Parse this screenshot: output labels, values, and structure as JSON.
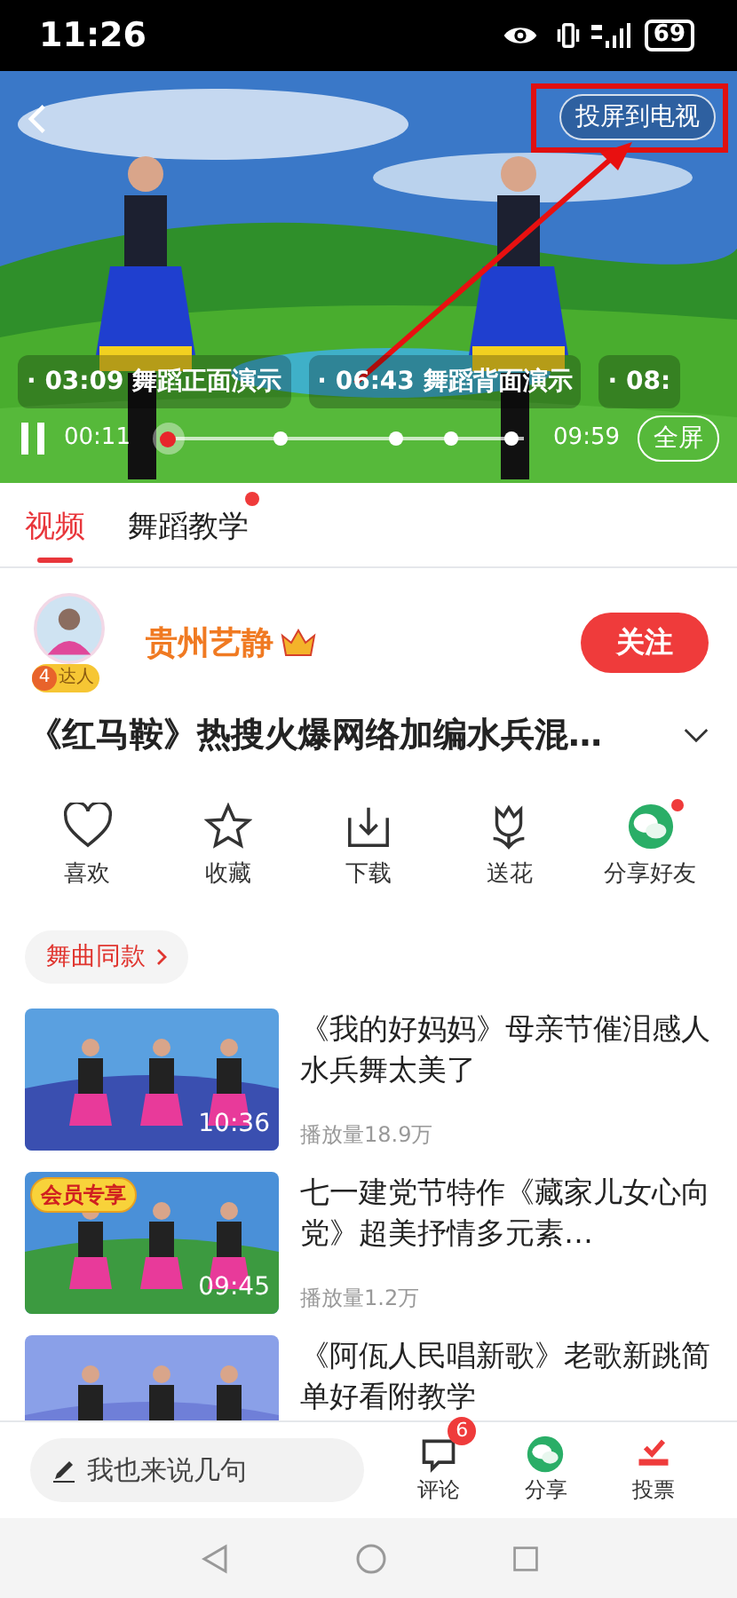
{
  "status_bar": {
    "time": "11:26",
    "battery": "69"
  },
  "player": {
    "cast_button": "投屏到电视",
    "chapters": [
      {
        "text": "· 03:09 舞蹈正面演示"
      },
      {
        "text": "· 06:43 舞蹈背面演示"
      },
      {
        "text": "· 08:"
      }
    ],
    "playing": true,
    "elapsed": "00:11",
    "duration": "09:59",
    "level": 0.02,
    "fullscreen": "全屏"
  },
  "tabs": [
    {
      "label": "视频",
      "selected": true,
      "dot": false
    },
    {
      "label": "舞蹈教学",
      "selected": false,
      "dot": true
    }
  ],
  "author": {
    "name": "贵州艺静",
    "level": "4",
    "rank": "达人",
    "follow": "关注"
  },
  "video_title": "《红马鞍》热搜火爆网络加编水兵混…",
  "actions": [
    {
      "kind": "heart",
      "label": "喜欢",
      "dot": false
    },
    {
      "kind": "star",
      "label": "收藏",
      "dot": false
    },
    {
      "kind": "download",
      "label": "下载",
      "dot": false
    },
    {
      "kind": "flower",
      "label": "送花",
      "dot": false
    },
    {
      "kind": "wechat",
      "label": "分享好友",
      "dot": true
    }
  ],
  "tag": "舞曲同款",
  "related": [
    {
      "title": "《我的好妈妈》母亲节催泪感人水兵舞太美了",
      "views": "播放量18.9万",
      "duration": "10:36"
    },
    {
      "title": "七一建党节特作《藏家儿女心向党》超美抒情多元素…",
      "views": "播放量1.2万",
      "duration": "09:45",
      "badge": "会员专享"
    },
    {
      "title": "《阿佤人民唱新歌》老歌新跳简单好看附教学"
    }
  ],
  "comment_bar": {
    "placeholder": "我也来说几句",
    "buttons": [
      {
        "kind": "comment",
        "label": "评论",
        "count": "6"
      },
      {
        "kind": "share",
        "label": "分享"
      },
      {
        "kind": "vote",
        "label": "投票"
      }
    ]
  }
}
